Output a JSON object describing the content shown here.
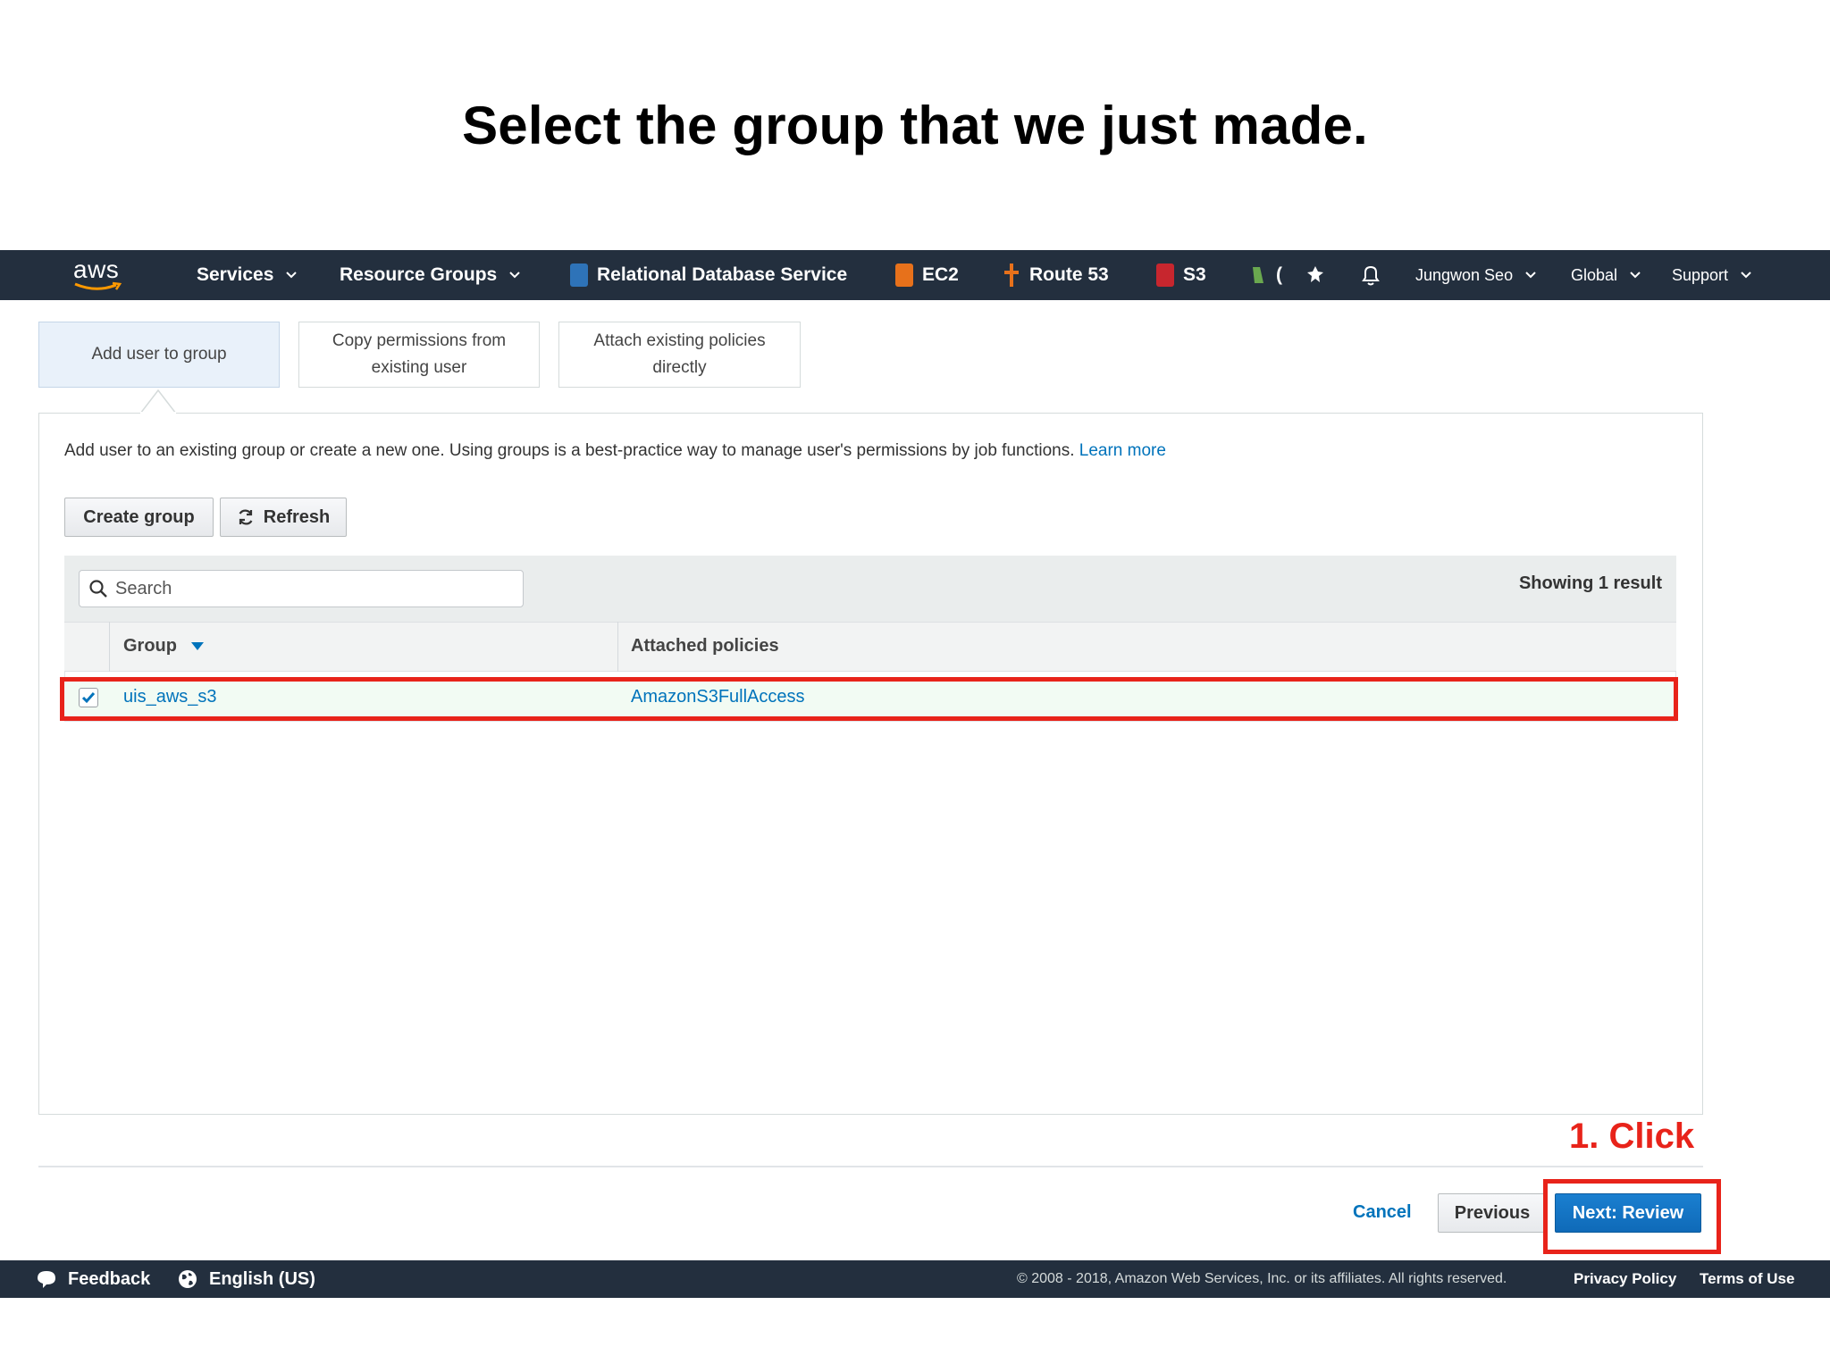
{
  "slide": {
    "title": "Select the group that we just made."
  },
  "topnav": {
    "logo_text": "aws",
    "services": "Services",
    "resource_groups": "Resource Groups",
    "pinned": [
      {
        "label": "Relational Database Service",
        "color": "#2e73b8"
      },
      {
        "label": "EC2",
        "color": "#e7711b"
      },
      {
        "label": "Route 53",
        "color": "#e7711b"
      },
      {
        "label": "S3",
        "color": "#c7262e"
      }
    ],
    "lambda_label": "(",
    "user": "Jungwon Seo",
    "region": "Global",
    "support": "Support"
  },
  "tabs": [
    {
      "line1": "Add user to group",
      "line2": "",
      "active": true
    },
    {
      "line1": "Copy permissions from",
      "line2": "existing user",
      "active": false
    },
    {
      "line1": "Attach existing policies",
      "line2": "directly",
      "active": false
    }
  ],
  "panel": {
    "intro": "Add user to an existing group or create a new one. Using groups is a best-practice way to manage user's permissions by job functions.",
    "learn_more": "Learn more",
    "create_group": "Create group",
    "refresh": "Refresh"
  },
  "table": {
    "search_placeholder": "Search",
    "showing": "Showing 1 result",
    "columns": [
      "Group",
      "Attached policies"
    ],
    "rows": [
      {
        "checked": true,
        "group": "uis_aws_s3",
        "policy": "AmazonS3FullAccess"
      }
    ]
  },
  "annotation": {
    "step": "1. Click",
    "color": "#e8231a"
  },
  "actions": {
    "cancel": "Cancel",
    "previous": "Previous",
    "next": "Next: Review"
  },
  "footer": {
    "feedback": "Feedback",
    "language": "English (US)",
    "copyright": "© 2008 - 2018, Amazon Web Services, Inc. or its affiliates. All rights reserved.",
    "privacy": "Privacy Policy",
    "terms": "Terms of Use"
  },
  "colors": {
    "nav_bg": "#232f3e",
    "link": "#0073bb",
    "primary": "#0f6ab8",
    "highlight": "#e8231a"
  }
}
